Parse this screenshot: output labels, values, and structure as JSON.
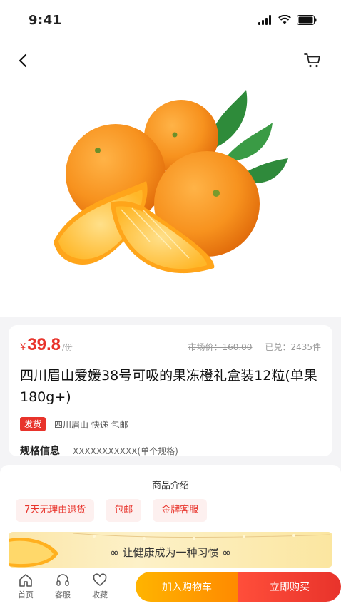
{
  "status_bar": {
    "time": "9:41"
  },
  "product": {
    "price_symbol": "¥",
    "price": "39.8",
    "price_unit": "/份",
    "market_price": "市场价：160.00",
    "sold": "已兑：2435件",
    "title": "四川眉山爱媛38号可吸的果冻橙礼盒装12粒(单果180g+)",
    "ship_tag": "发货",
    "ship_info": "四川眉山 快递 包邮",
    "spec_label": "规格信息",
    "spec_value": "XXXXXXXXXXX(单个规格)"
  },
  "intro": {
    "title": "商品介绍",
    "tags": [
      "7天无理由退货",
      "包邮",
      "金牌客服"
    ],
    "banner": "∞ 让健康成为一种习惯 ∞"
  },
  "bottom_bar": {
    "tabs": [
      {
        "label": "首页",
        "icon": "home-icon"
      },
      {
        "label": "客服",
        "icon": "headset-icon"
      },
      {
        "label": "收藏",
        "icon": "heart-icon"
      }
    ],
    "add_to_cart": "加入购物车",
    "buy_now": "立即购买"
  },
  "colors": {
    "accent_red": "#e8332b",
    "accent_orange": "#ff9a00"
  }
}
